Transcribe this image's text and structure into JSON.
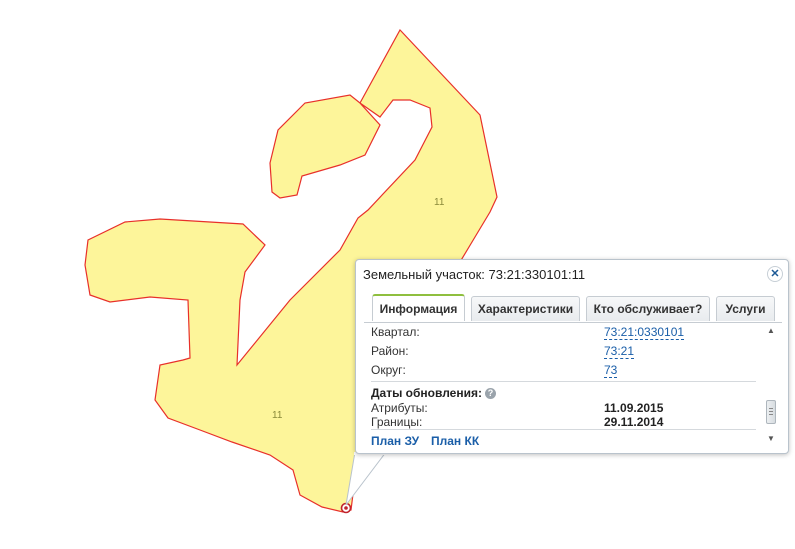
{
  "map": {
    "parcel_labels": [
      "11",
      "11"
    ],
    "colors": {
      "parcel_fill": "#fdf59a",
      "parcel_stroke": "#e8302a",
      "marker": "#c0242e"
    }
  },
  "popup": {
    "title": "Земельный участок: 73:21:330101:11",
    "close_icon": "close-icon",
    "tabs": [
      {
        "label": "Информация",
        "active": true
      },
      {
        "label": "Характеристики",
        "active": false
      },
      {
        "label": "Кто обслуживает?",
        "active": false
      },
      {
        "label": "Услуги",
        "active": false
      }
    ],
    "info": {
      "kvartal_label": "Квартал:",
      "kvartal_value": "73:21:0330101",
      "rayon_label": "Район:",
      "rayon_value": "73:21",
      "okrug_label": "Округ:",
      "okrug_value": "73",
      "dates_heading": "Даты обновления:",
      "help_icon": "?",
      "attributes_label": "Атрибуты:",
      "attributes_value": "11.09.2015",
      "borders_label": "Границы:",
      "borders_value": "29.11.2014"
    },
    "links": {
      "plan_zu": "План ЗУ",
      "plan_kk": "План КК"
    }
  }
}
